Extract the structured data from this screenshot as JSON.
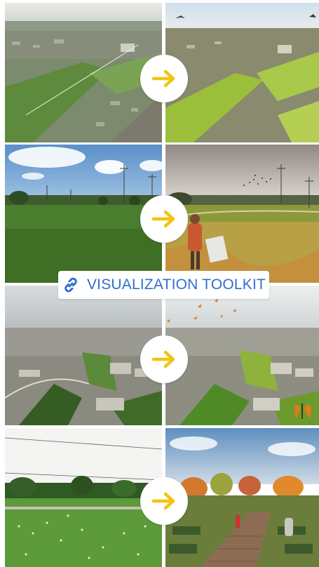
{
  "toolkit": {
    "label": "VISUALIZATION TOOLKIT",
    "icon": "link-icon"
  },
  "colors": {
    "accent": "#2f6fd0",
    "arrow": "#f1c40f"
  },
  "rows": [
    {
      "before": "aerial-suburb-before",
      "after": "aerial-suburb-after",
      "arrow_icon": "arrow-right-icon"
    },
    {
      "before": "field-hydro-before",
      "after": "meadow-visitor-after",
      "arrow_icon": "arrow-right-icon"
    },
    {
      "before": "aerial-industrial-before",
      "after": "aerial-industrial-after",
      "arrow_icon": "arrow-right-icon"
    },
    {
      "before": "park-field-before",
      "after": "garden-boardwalk-after",
      "arrow_icon": "arrow-right-icon"
    }
  ]
}
